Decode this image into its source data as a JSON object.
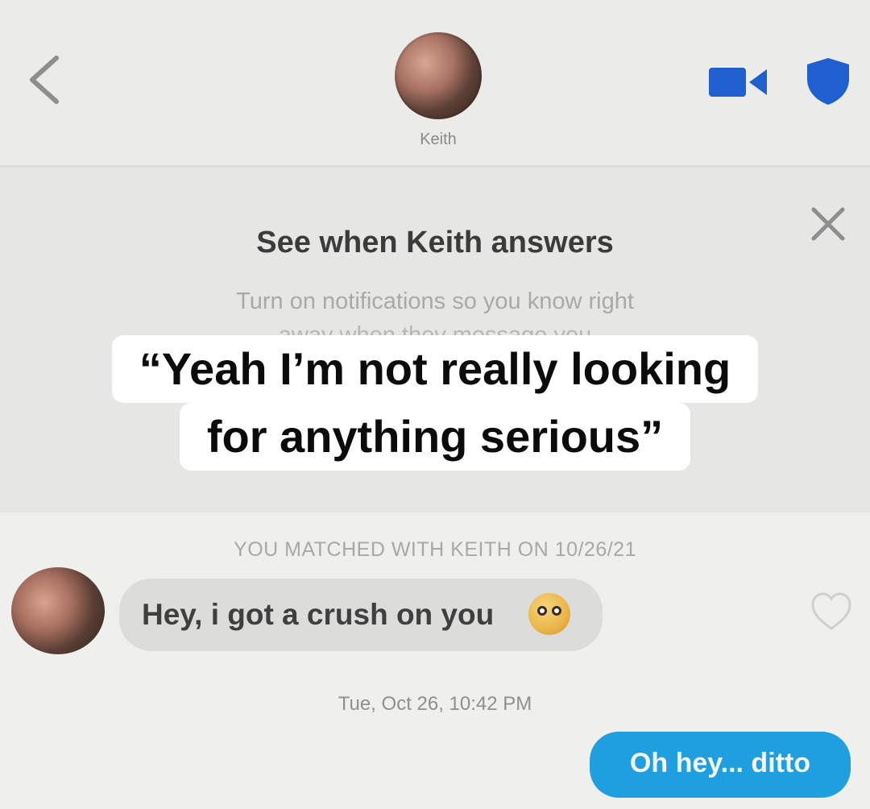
{
  "header": {
    "contact_name": "Keith",
    "accent_color": "#1f5fd0",
    "icons": [
      "chevron-left-icon",
      "video-camera-icon",
      "shield-icon"
    ]
  },
  "notification_banner": {
    "title": "See when Keith answers",
    "subtitle": "Turn on notifications so you know right",
    "subtitle_cont": "away when they message you"
  },
  "overlay_caption": {
    "line1": "“Yeah I’m not really looking",
    "line2": "for anything serious”"
  },
  "conversation": {
    "match_note": "YOU MATCHED WITH KEITH ON 10/26/21",
    "incoming_message": "Hey, i got a crush on you",
    "incoming_emoji": "flushed-face-emoji",
    "timestamp": "Tue, Oct 26, 10:42 PM",
    "outgoing_message": "Oh hey... ditto",
    "outgoing_bubble_color": "#1f9ee0"
  }
}
